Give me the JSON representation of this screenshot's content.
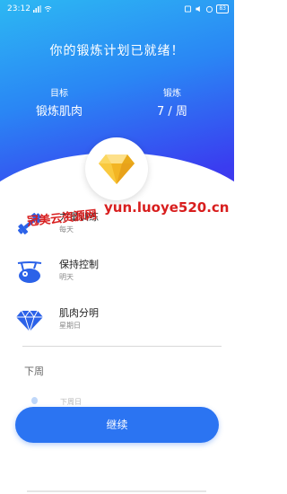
{
  "status_bar": {
    "time": "23:12",
    "battery": "83"
  },
  "header": {
    "title": "你的锻炼计划已就绪！",
    "goal_label": "目标",
    "goal_value": "锻炼肌肉",
    "training_label": "锻炼",
    "training_value": "7 / 周"
  },
  "plan_items": [
    {
      "title": "力量训练",
      "subtitle": "每天",
      "icon": "dumbbell-icon"
    },
    {
      "title": "保持控制",
      "subtitle": "明天",
      "icon": "sloth-icon"
    },
    {
      "title": "肌肉分明",
      "subtitle": "星期日",
      "icon": "diamond-icon"
    }
  ],
  "section": {
    "label": "下周",
    "faded_text": "下周日"
  },
  "watermark": {
    "cn": "冠美云资源网",
    "url": "yun.luoye520.cn"
  },
  "cta": {
    "label": "继续"
  },
  "colors": {
    "hero_gradient_start": "#2db8f3",
    "hero_gradient_end": "#4a2ee8",
    "accent": "#2b74f2",
    "gem_yellow": "#f7c32e",
    "watermark": "#d81e1e"
  }
}
